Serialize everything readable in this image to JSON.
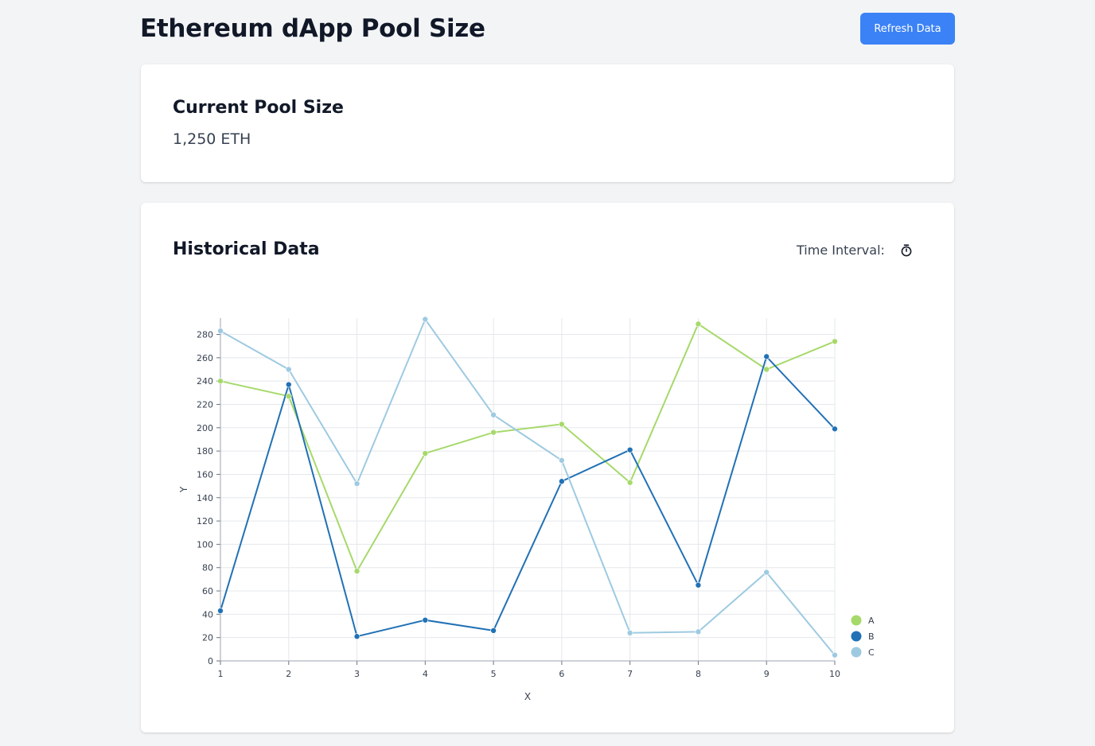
{
  "header": {
    "title": "Ethereum dApp Pool Size",
    "refresh_label": "Refresh Data"
  },
  "pool": {
    "title": "Current Pool Size",
    "value": "1,250 ETH"
  },
  "history": {
    "title": "Historical Data",
    "interval_label": "Time Interval:",
    "interval_icon": "stopwatch-icon"
  },
  "colors": {
    "accent": "#3b82f6",
    "background": "#f3f4f6"
  },
  "chart_data": {
    "type": "line",
    "xlabel": "X",
    "ylabel": "Y",
    "x": [
      1,
      2,
      3,
      4,
      5,
      6,
      7,
      8,
      9,
      10
    ],
    "xlim": [
      1,
      10
    ],
    "ylim": [
      0,
      294
    ],
    "yticks": [
      0,
      20,
      40,
      60,
      80,
      100,
      120,
      140,
      160,
      180,
      200,
      220,
      240,
      260,
      280
    ],
    "grid": true,
    "legend_position": "bottom-right",
    "series": [
      {
        "name": "A",
        "color": "#a6d96a",
        "values": [
          240,
          227,
          77,
          178,
          196,
          203,
          153,
          289,
          250,
          274
        ]
      },
      {
        "name": "B",
        "color": "#2171b5",
        "values": [
          43,
          237,
          21,
          35,
          26,
          154,
          181,
          65,
          261,
          199
        ]
      },
      {
        "name": "C",
        "color": "#9ecae1",
        "values": [
          283,
          250,
          152,
          293,
          211,
          172,
          24,
          25,
          76,
          5
        ]
      }
    ]
  }
}
